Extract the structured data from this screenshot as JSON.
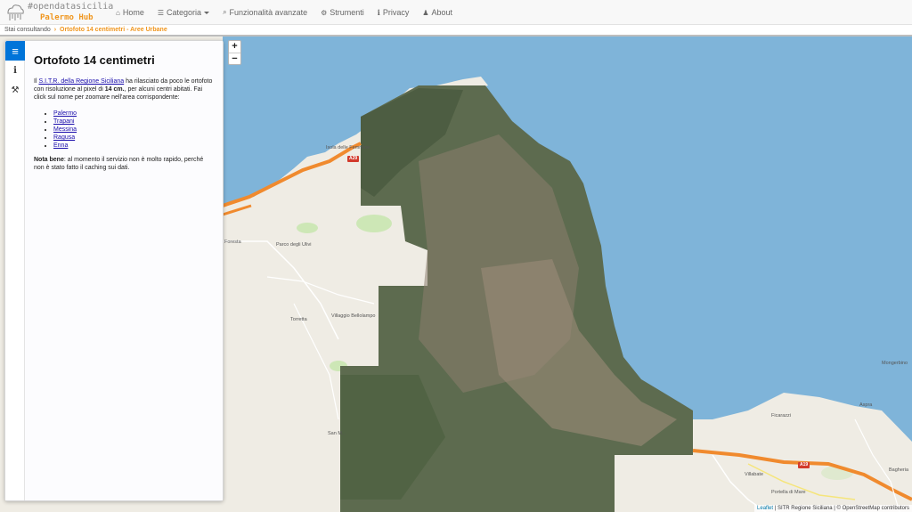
{
  "brand": {
    "line1": "#opendatasicilia",
    "line2": "Palermo Hub"
  },
  "nav": {
    "items": [
      {
        "icon": "home-icon",
        "glyph": "⌂",
        "label": "Home"
      },
      {
        "icon": "list-icon",
        "glyph": "☰",
        "label": "Categoria"
      },
      {
        "icon": "search-icon",
        "glyph": "⌕",
        "label": "Funzionalità avanzate"
      },
      {
        "icon": "gear-icon",
        "glyph": "⚙",
        "label": "Strumenti"
      },
      {
        "icon": "info-icon",
        "glyph": "i",
        "label": "Privacy"
      },
      {
        "icon": "users-icon",
        "glyph": "♟",
        "label": "About"
      }
    ]
  },
  "breadcrumb": {
    "prefix": "Stai consultando",
    "current": "Ortofoto 14 centimetri - Aree Urbane"
  },
  "sidebar": {
    "tabs": [
      {
        "icon": "menu-icon",
        "glyph": "≡"
      },
      {
        "icon": "info-icon",
        "glyph": "i"
      },
      {
        "icon": "wrench-icon",
        "glyph": "⚒"
      }
    ],
    "title": "Ortofoto 14 centimetri",
    "intro_pre": "Il ",
    "intro_link": "S.I.T.R. della Regione Siciliana",
    "intro_mid": " ha rilasciato da poco le ortofoto con risoluzione al pixel di ",
    "intro_bold": "14 cm.",
    "intro_post": ", per alcuni centri abitati. Fai click sul nome per zoomare nell'area corrispondente:",
    "cities": [
      "Palermo",
      "Trapani",
      "Messina",
      "Ragusa",
      "Enna"
    ],
    "note_bold": "Nota bene",
    "note_text": ": al momento il servizio non è molto rapido, perché non è stato fatto il caching sui dati."
  },
  "map": {
    "zoom_in": "+",
    "zoom_out": "−",
    "labels": {
      "isola": "Isola delle Femmine",
      "foresta": "Foresta",
      "parco": "Parco degli Ulivi",
      "torretta": "Torretta",
      "villaggio": "Villaggio Bellolampo",
      "sanm": "San M...",
      "mongerbino": "Mongerbino",
      "aspra": "Aspra",
      "ficarazzi": "Ficarazzi",
      "villabate": "Villabate",
      "portella": "Portella di Mare",
      "bagheria": "Bagheria",
      "a29": "A29",
      "a19": "A19"
    },
    "attribution": {
      "leaflet": "Leaflet",
      "rest": " | SITR Regione Siciliana | © OpenStreetMap contributors"
    },
    "colors": {
      "sea": "#7fb4d9",
      "land": "#efece4",
      "motorway": "#f08a2e",
      "ortho": "#5d6b4f"
    }
  }
}
